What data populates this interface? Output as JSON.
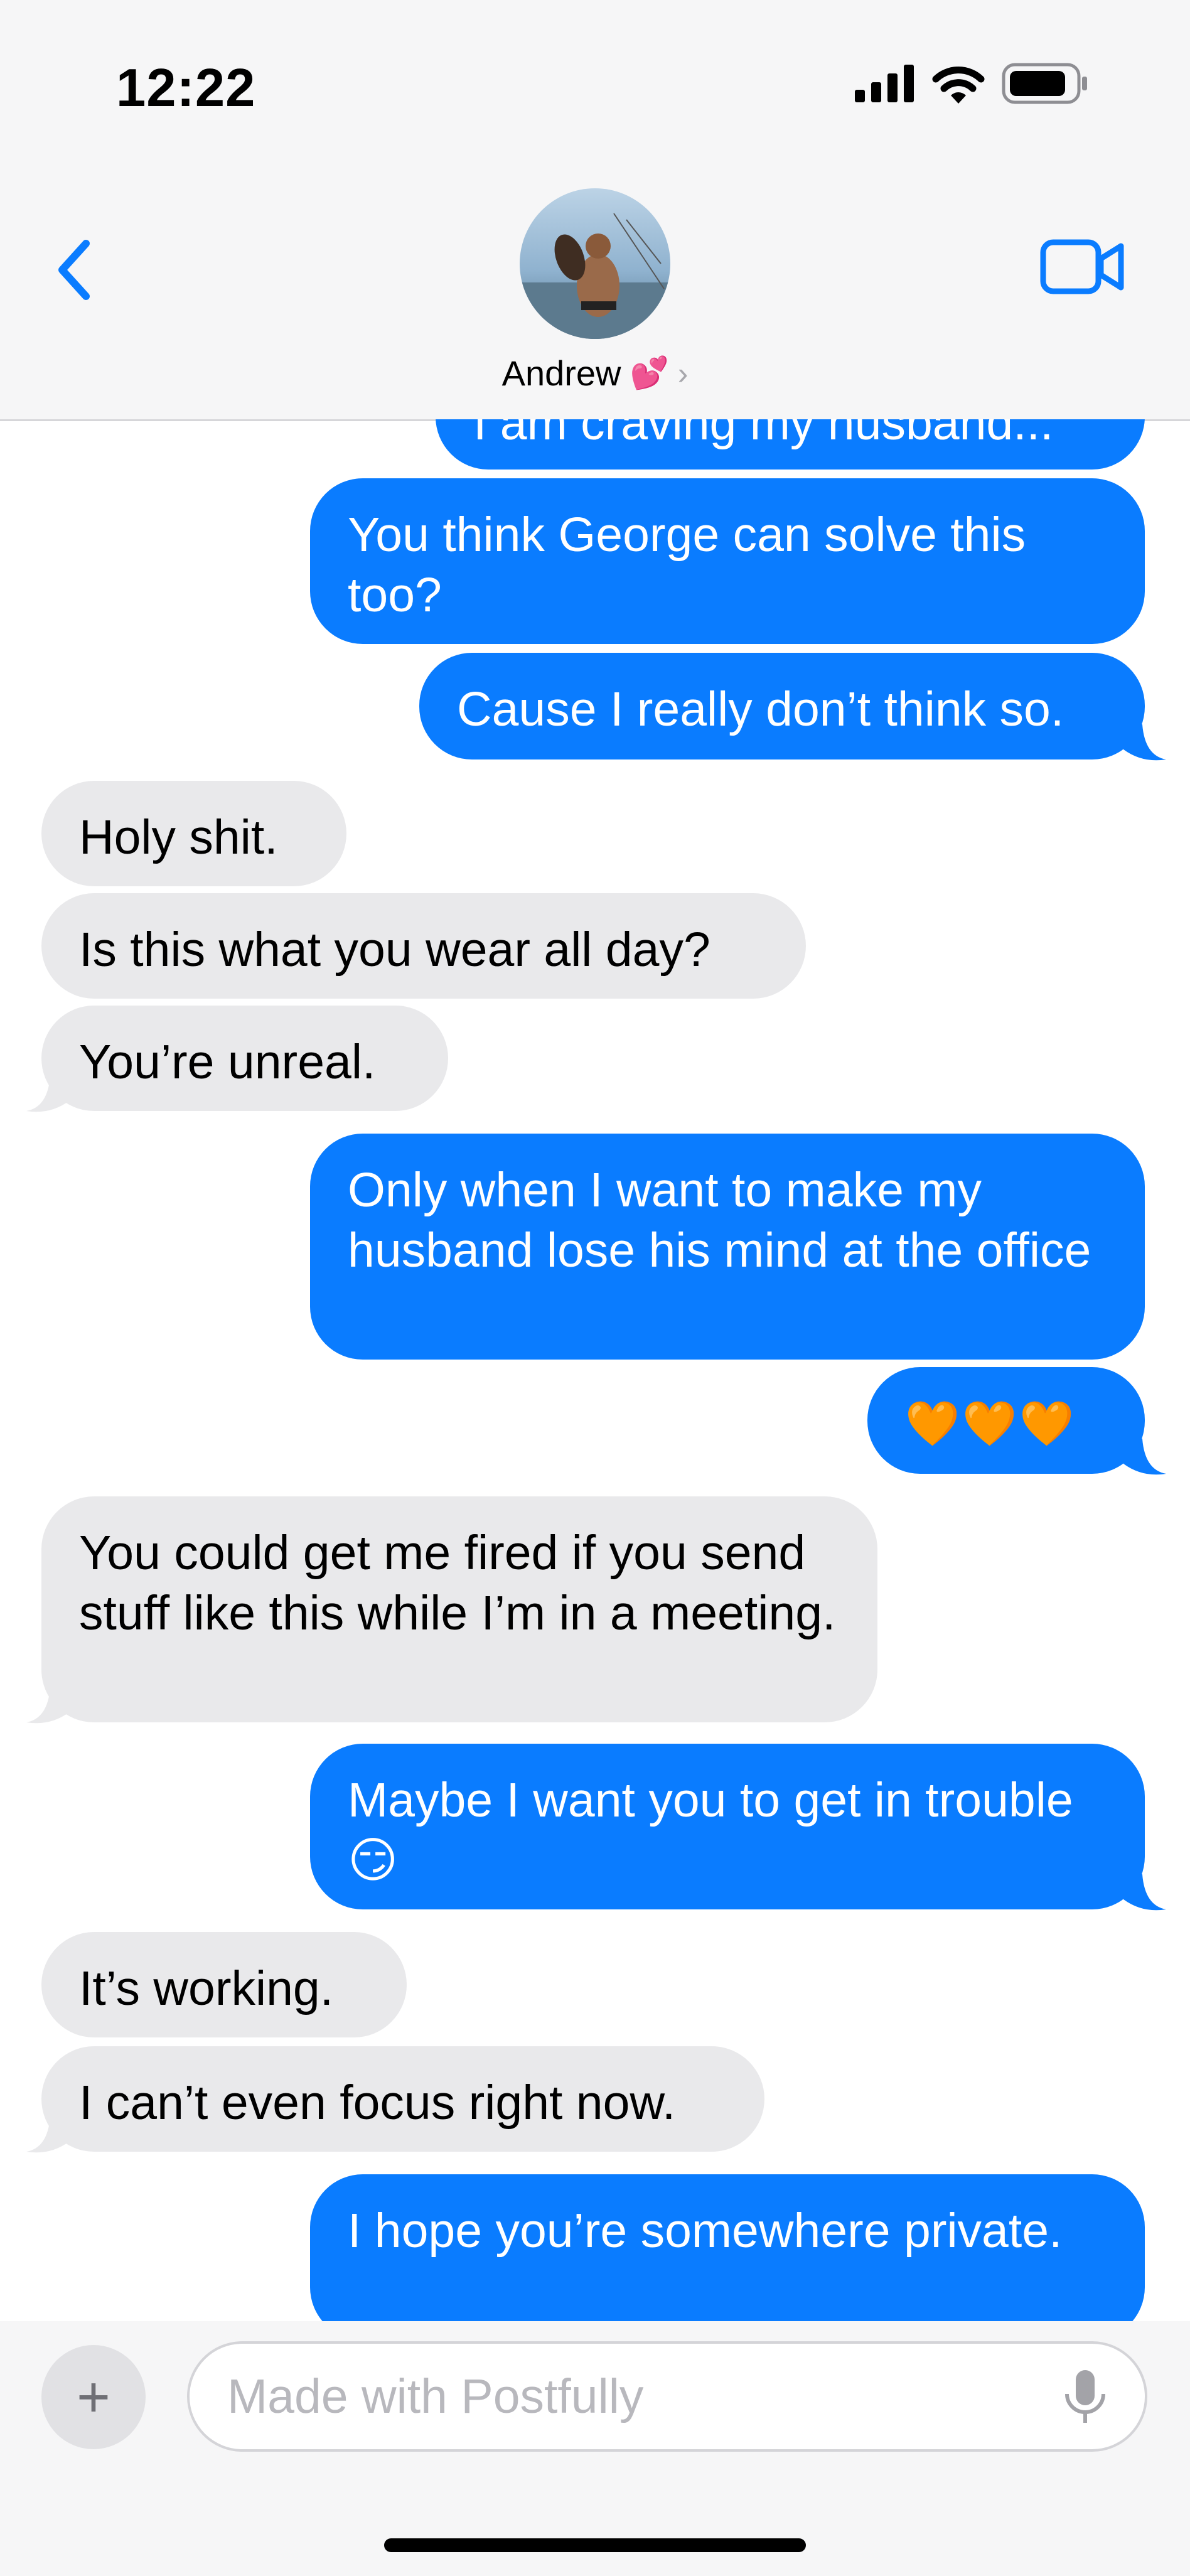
{
  "status_bar": {
    "time": "12:22"
  },
  "header": {
    "contact_name": "Andrew",
    "name_emoji": "💕",
    "chevron": "›"
  },
  "messages": [
    {
      "sender": "me",
      "text": "I am craving my husband..."
    },
    {
      "sender": "me",
      "text": "You think George can solve this too?"
    },
    {
      "sender": "me",
      "text": "Cause I really don’t think so."
    },
    {
      "sender": "them",
      "text": "Holy shit."
    },
    {
      "sender": "them",
      "text": "Is this what you wear all day?"
    },
    {
      "sender": "them",
      "text": "You’re unreal."
    },
    {
      "sender": "me",
      "text": "Only when I want to make my husband lose his mind at the office"
    },
    {
      "sender": "me",
      "text": "🧡🧡🧡"
    },
    {
      "sender": "them",
      "text": "You could get me fired if you send stuff like this while I’m in a meeting."
    },
    {
      "sender": "me",
      "text": "Maybe I want you to get in trouble 😏"
    },
    {
      "sender": "them",
      "text": "It’s working."
    },
    {
      "sender": "them",
      "text": "I can’t even focus right now."
    },
    {
      "sender": "me",
      "text": "I hope you’re somewhere private."
    }
  ],
  "composer": {
    "plus": "+",
    "placeholder": "Made with Postfully"
  },
  "colors": {
    "outgoing_bubble": "#0a7cff",
    "incoming_bubble": "#e9e9eb",
    "accent": "#0a7cff"
  },
  "icons": [
    "signal-icon",
    "wifi-icon",
    "battery-icon",
    "back-chevron-icon",
    "video-call-icon",
    "mic-icon",
    "plus-icon"
  ]
}
